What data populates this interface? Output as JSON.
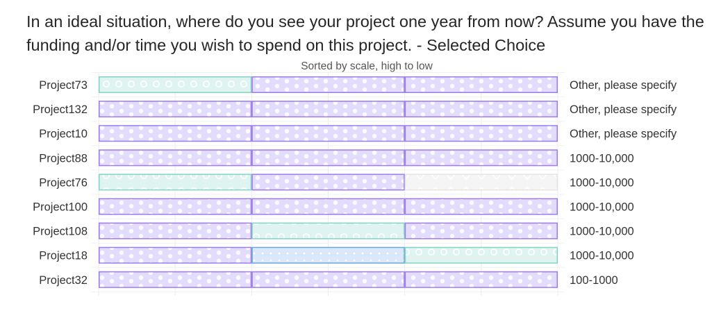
{
  "question": "In an ideal situation, where do you see your project one year from now? Assume you have the funding and/or time you wish to spend on this project. - Selected Choice",
  "colors": {
    "purple_fill": "#e4dcfd",
    "purple_stroke": "#9b7cf0",
    "teal_fill": "#dff4f0",
    "teal_stroke": "#83d3c4",
    "blue_fill": "#dbe8fb",
    "blue_stroke": "#6aa7e0",
    "gray_fill": "#f5f5f5",
    "gray_stroke": "#e4e4e4"
  },
  "chart_data": {
    "type": "bar",
    "subtitle": "Sorted by scale, high to low",
    "segments_per_row": 3,
    "rows": [
      {
        "project": "Project73",
        "choice": "Other, please specify",
        "segments": [
          "teal",
          "purple",
          "purple"
        ]
      },
      {
        "project": "Project132",
        "choice": "Other, please specify",
        "segments": [
          "purple",
          "purple",
          "purple"
        ]
      },
      {
        "project": "Project10",
        "choice": "Other, please specify",
        "segments": [
          "purple",
          "purple",
          "purple"
        ]
      },
      {
        "project": "Project88",
        "choice": "1000-10,000",
        "segments": [
          "purple",
          "purple",
          "purple"
        ]
      },
      {
        "project": "Project76",
        "choice": "1000-10,000",
        "segments": [
          "teal",
          "purple",
          "gray"
        ]
      },
      {
        "project": "Project100",
        "choice": "1000-10,000",
        "segments": [
          "purple",
          "purple",
          "purple"
        ]
      },
      {
        "project": "Project108",
        "choice": "1000-10,000",
        "segments": [
          "purple",
          "teal",
          "purple"
        ]
      },
      {
        "project": "Project18",
        "choice": "1000-10,000",
        "segments": [
          "purple",
          "blue",
          "teal"
        ]
      },
      {
        "project": "Project32",
        "choice": "100-1000",
        "segments": [
          "purple",
          "purple",
          "purple"
        ]
      }
    ]
  }
}
